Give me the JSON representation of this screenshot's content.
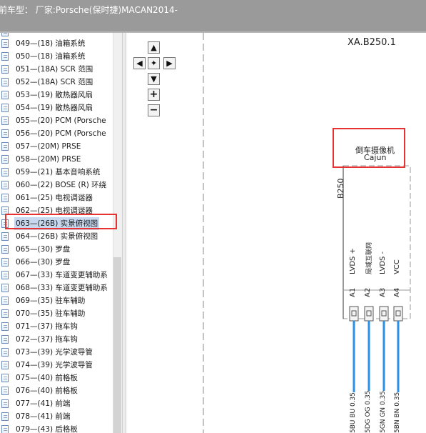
{
  "header": {
    "title": "前车型： 厂家:Porsche(保时捷)MACAN2014-"
  },
  "tree": {
    "selected_index": 15,
    "items": [
      "049—(18) 油箱系统",
      "050—(18) 油箱系统",
      "051—(18A) SCR 范围",
      "052—(18A) SCR 范围",
      "053—(19) 散热器风扇",
      "054—(19) 散热器风扇",
      "055—(20) PCM (Porsche",
      "056—(20) PCM (Porsche",
      "057—(20M) PRSE",
      "058—(20M) PRSE",
      "059—(21) 基本音响系统",
      "060—(22) BOSE (R) 环绕",
      "061—(25) 电视调谐器",
      "062—(25) 电视调谐器",
      "063—(26B) 实景俯视图",
      "064—(26B) 实景俯视图",
      "065—(30) 罗盘",
      "066—(30) 罗盘",
      "067—(33) 车道变更辅助系",
      "068—(33) 车道变更辅助系",
      "069—(35) 驻车辅助",
      "070—(35) 驻车辅助",
      "071—(37) 拖车钩",
      "072—(37) 拖车钩",
      "073—(39) 光学波导管",
      "074—(39) 光学波导管",
      "075—(40) 前格板",
      "076—(40) 前格板",
      "077—(41) 前端",
      "078—(41) 前端",
      "079—(43) 后格板"
    ]
  },
  "toolbar": {
    "up_icon": "arrow-up-icon",
    "left_icon": "arrow-left-icon",
    "center_icon": "pan-center-icon",
    "right_icon": "arrow-right-icon",
    "down_icon": "arrow-down-icon",
    "zoom_in_icon": "zoom-in-icon",
    "zoom_out_icon": "zoom-out-icon"
  },
  "schematic": {
    "component_id": "XA.B250.1",
    "component_name": "倒车摄像机",
    "component_sub": "Cajun",
    "connector_label": "B250",
    "pins": [
      {
        "pin": "A1",
        "signal": "LVDS +",
        "wire": "5BU BU 0.35"
      },
      {
        "pin": "A2",
        "signal": "局域互联网",
        "wire": "5DG OG 0.35"
      },
      {
        "pin": "A3",
        "signal": "LVDS -",
        "wire": "5GN GN 0.35"
      },
      {
        "pin": "A4",
        "signal": "VCC",
        "wire": "5BN BN 0.35"
      }
    ]
  },
  "colors": {
    "highlight_red": "#e53232",
    "wire_blue": "#2a8fe8",
    "header_gray": "#9a9a9a",
    "selection": "#c8d9ef"
  }
}
